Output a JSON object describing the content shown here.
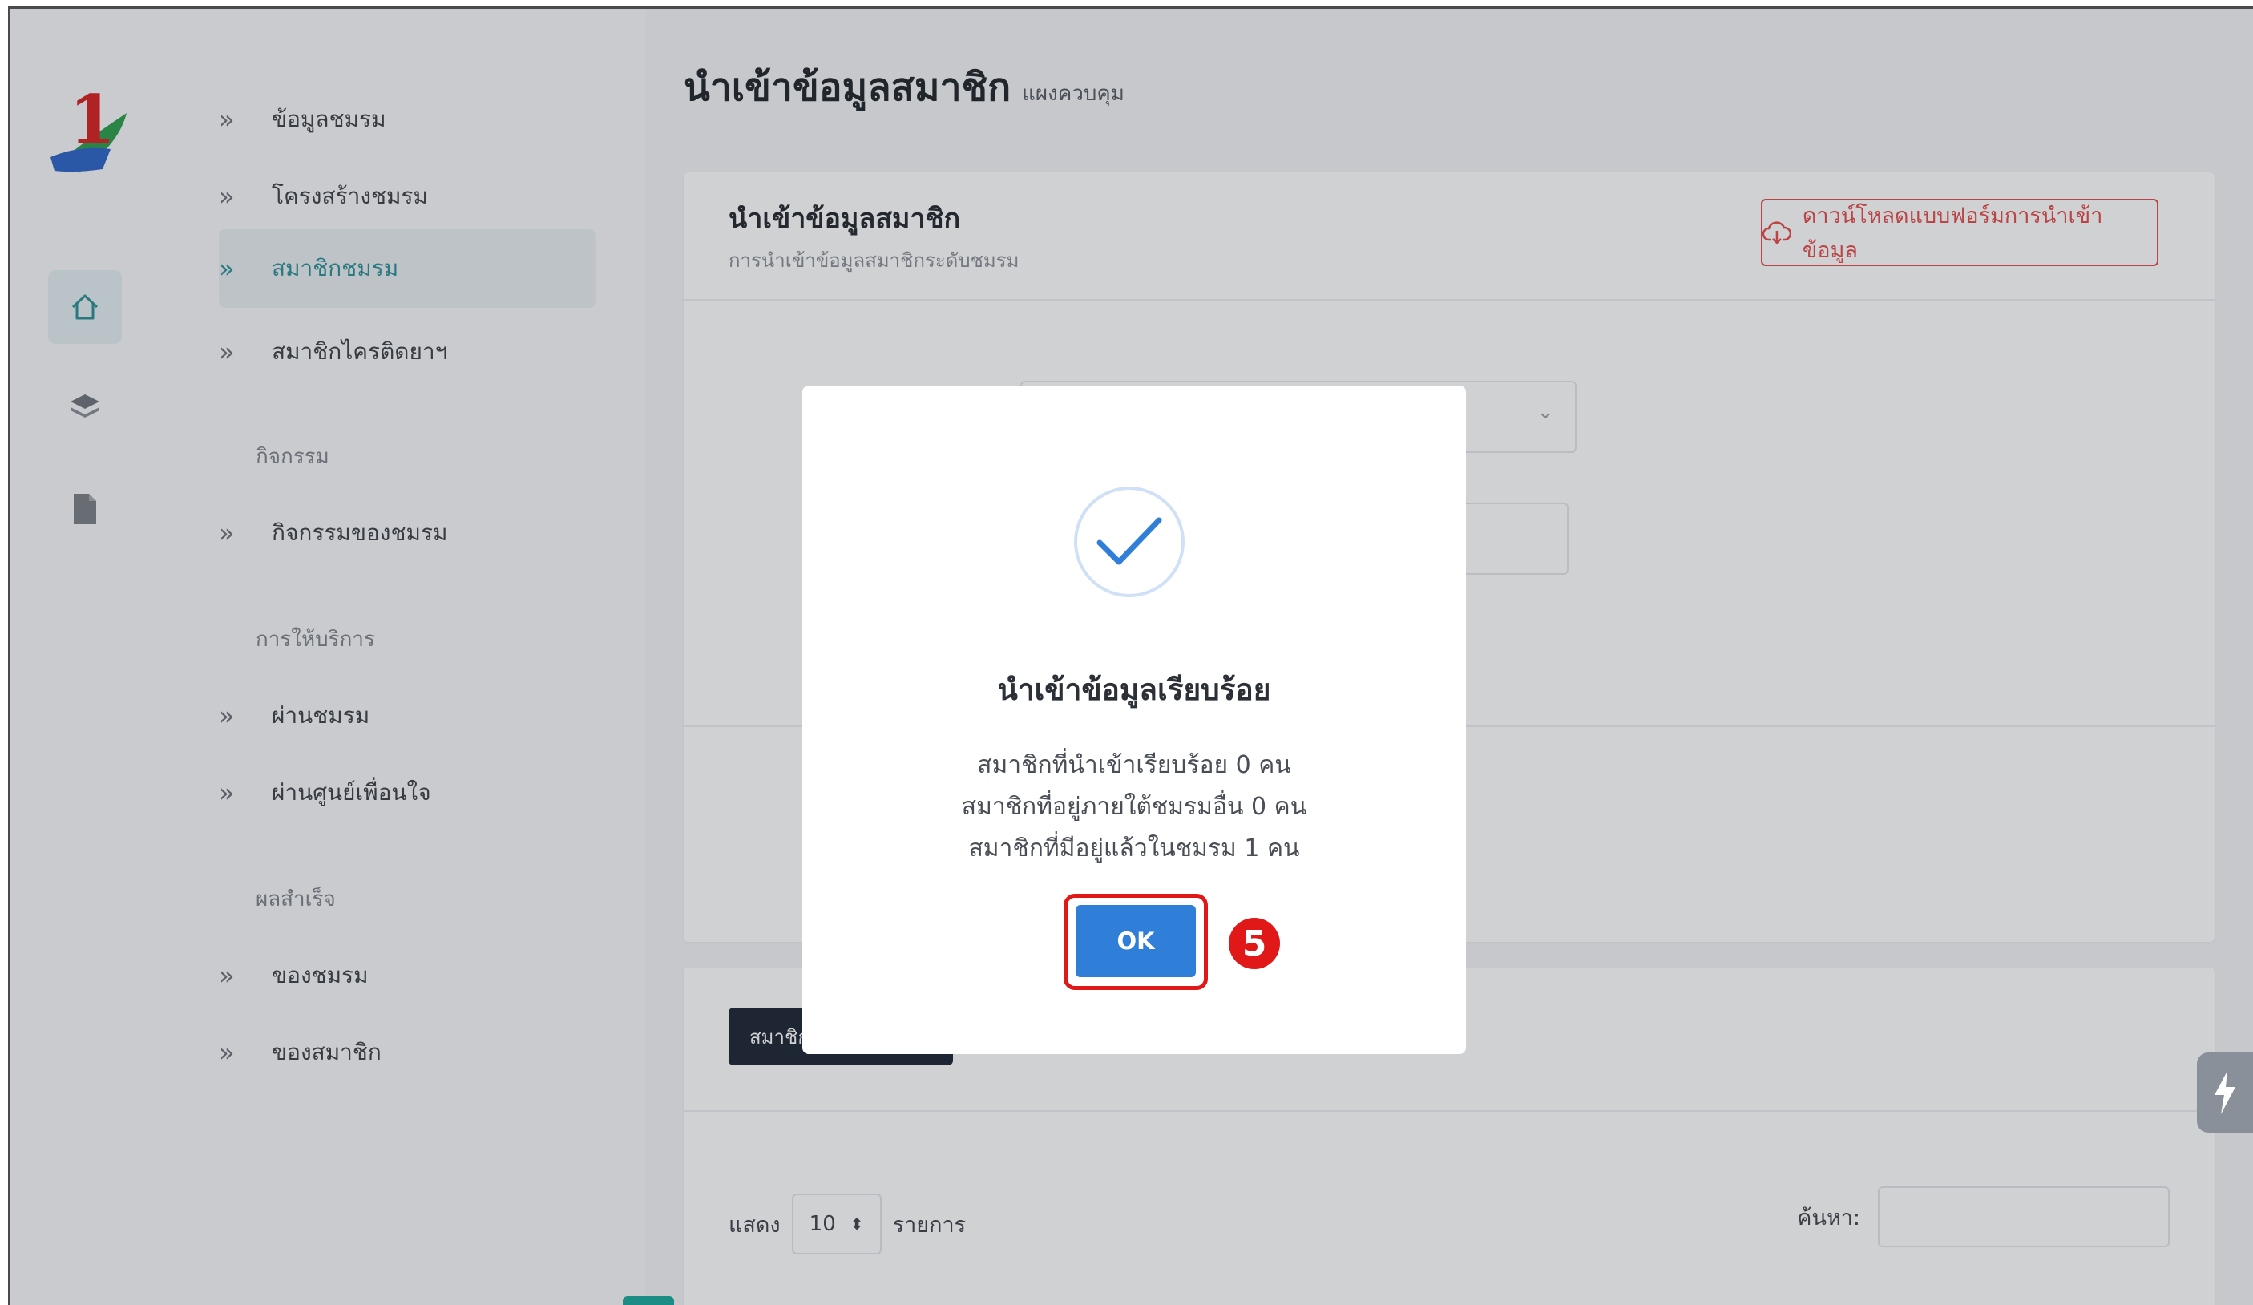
{
  "page": {
    "title": "นำเข้าข้อมูลสมาชิก",
    "subtitle": "แผงควบคุม"
  },
  "sidebar": {
    "items": [
      {
        "label": "ข้อมูลชมรม"
      },
      {
        "label": "โครงสร้างชมรม"
      },
      {
        "label": "สมาชิกชมรม"
      },
      {
        "label": "สมาชิกไครติดยาฯ"
      }
    ],
    "section_activity": "กิจกรรม",
    "activity_items": [
      {
        "label": "กิจกรรมของชมรม"
      }
    ],
    "section_service": "การให้บริการ",
    "service_items": [
      {
        "label": "ผ่านชมรม"
      },
      {
        "label": "ผ่านศูนย์เพื่อนใจ"
      }
    ],
    "section_results": "ผลสำเร็จ",
    "results_items": [
      {
        "label": "ของชมรม"
      },
      {
        "label": "ของสมาชิก"
      }
    ]
  },
  "card": {
    "title": "นำเข้าข้อมูลสมาชิก",
    "subtitle": "การนำเข้าข้อมูลสมาชิกระดับชมรม",
    "download_button": "ดาวน์โหลดแบบฟอร์มการนำเข้าข้อมูล"
  },
  "table": {
    "tab_label": "สมาชิก",
    "show_label": "แสดง",
    "page_length": "10",
    "entries_label": "รายการ",
    "search_label": "ค้นหา:"
  },
  "modal": {
    "title": "นำเข้าข้อมูลเรียบร้อย",
    "line1": "สมาชิกที่นำเข้าเรียบร้อย 0 คน",
    "line2": "สมาชิกที่อยู่ภายใต้ชมรมอื่น 0 คน",
    "line3": "สมาชิกที่มีอยู่แล้วในชมรม 1 คน",
    "ok_button": "OK",
    "step_number": "5"
  },
  "colors": {
    "accent_red": "#e01818",
    "ok_blue": "#2f7ed8",
    "dark_tab": "#1b2333"
  }
}
